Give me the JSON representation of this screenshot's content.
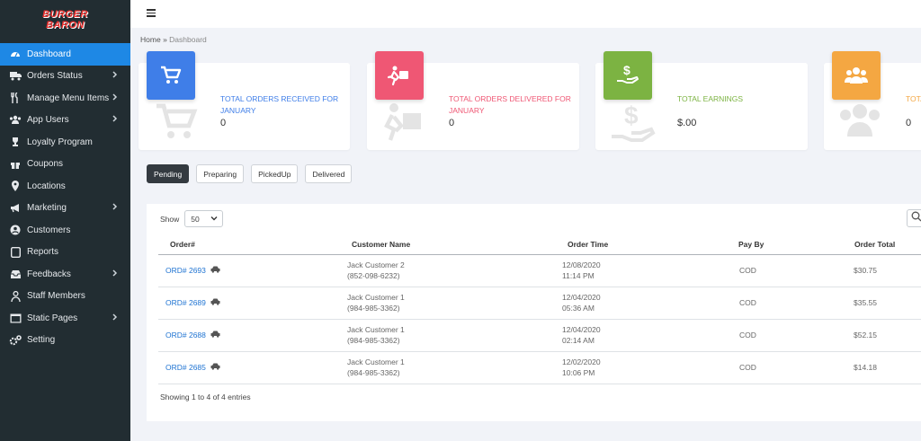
{
  "brand": {
    "line1": "BURGER",
    "line2": "BARON"
  },
  "sidebar": {
    "items": [
      {
        "label": "Dashboard",
        "icon": "dashboard-icon",
        "active": true,
        "chevron": false
      },
      {
        "label": "Orders Status",
        "icon": "truck-icon",
        "chevron": true
      },
      {
        "label": "Manage Menu Items",
        "icon": "utensils-icon",
        "chevron": true
      },
      {
        "label": "App Users",
        "icon": "users-icon",
        "chevron": true
      },
      {
        "label": "Loyalty Program",
        "icon": "trophy-icon",
        "chevron": false
      },
      {
        "label": "Coupons",
        "icon": "gift-icon",
        "chevron": false
      },
      {
        "label": "Locations",
        "icon": "map-marker-icon",
        "chevron": false
      },
      {
        "label": "Marketing",
        "icon": "bullhorn-icon",
        "chevron": true
      },
      {
        "label": "Customers",
        "icon": "user-circle-icon",
        "chevron": false
      },
      {
        "label": "Reports",
        "icon": "report-icon",
        "chevron": false
      },
      {
        "label": "Feedbacks",
        "icon": "inbox-icon",
        "chevron": true
      },
      {
        "label": "Staff Members",
        "icon": "staff-icon",
        "chevron": false
      },
      {
        "label": "Static Pages",
        "icon": "window-icon",
        "chevron": true
      },
      {
        "label": "Setting",
        "icon": "gears-icon",
        "chevron": false
      }
    ]
  },
  "breadcrumb": {
    "home": "Home",
    "sep": "»",
    "current": "Dashboard"
  },
  "cards": [
    {
      "title": "TOTAL ORDERS RECEIVED FOR JANUARY",
      "value": "0",
      "color": "#3f7ee8",
      "icon": "cart-icon"
    },
    {
      "title": "TOTAL ORDERS DELIVERED FOR JANUARY",
      "value": "0",
      "color": "#ef5774",
      "icon": "delivery-icon"
    },
    {
      "title": "TOTAL EARNINGS",
      "value": "$.00",
      "color": "#7cb342",
      "icon": "money-hand-icon"
    },
    {
      "title": "TOTA",
      "value": "0",
      "color": "#f4a742",
      "icon": "users-group-icon"
    }
  ],
  "filters": [
    "Pending",
    "Preparing",
    "PickedUp",
    "Delivered"
  ],
  "table": {
    "show_label": "Show",
    "page_size": "50",
    "headers": [
      "Order#",
      "Customer Name",
      "Order Time",
      "Pay By",
      "Order Total"
    ],
    "rows": [
      {
        "order": "ORD# 2693",
        "customer": "Jack Customer 2",
        "phone": "(852-098-6232)",
        "date": "12/08/2020",
        "time": "11:14 PM",
        "pay": "COD",
        "total": "$30.75"
      },
      {
        "order": "ORD# 2689",
        "customer": "Jack Customer 1",
        "phone": "(984-985-3362)",
        "date": "12/04/2020",
        "time": "05:36 AM",
        "pay": "COD",
        "total": "$35.55"
      },
      {
        "order": "ORD# 2688",
        "customer": "Jack Customer 1",
        "phone": "(984-985-3362)",
        "date": "12/04/2020",
        "time": "02:14 AM",
        "pay": "COD",
        "total": "$52.15"
      },
      {
        "order": "ORD# 2685",
        "customer": "Jack Customer 1",
        "phone": "(984-985-3362)",
        "date": "12/02/2020",
        "time": "10:06 PM",
        "pay": "COD",
        "total": "$14.18"
      }
    ],
    "info": "Showing 1 to 4 of 4 entries"
  }
}
